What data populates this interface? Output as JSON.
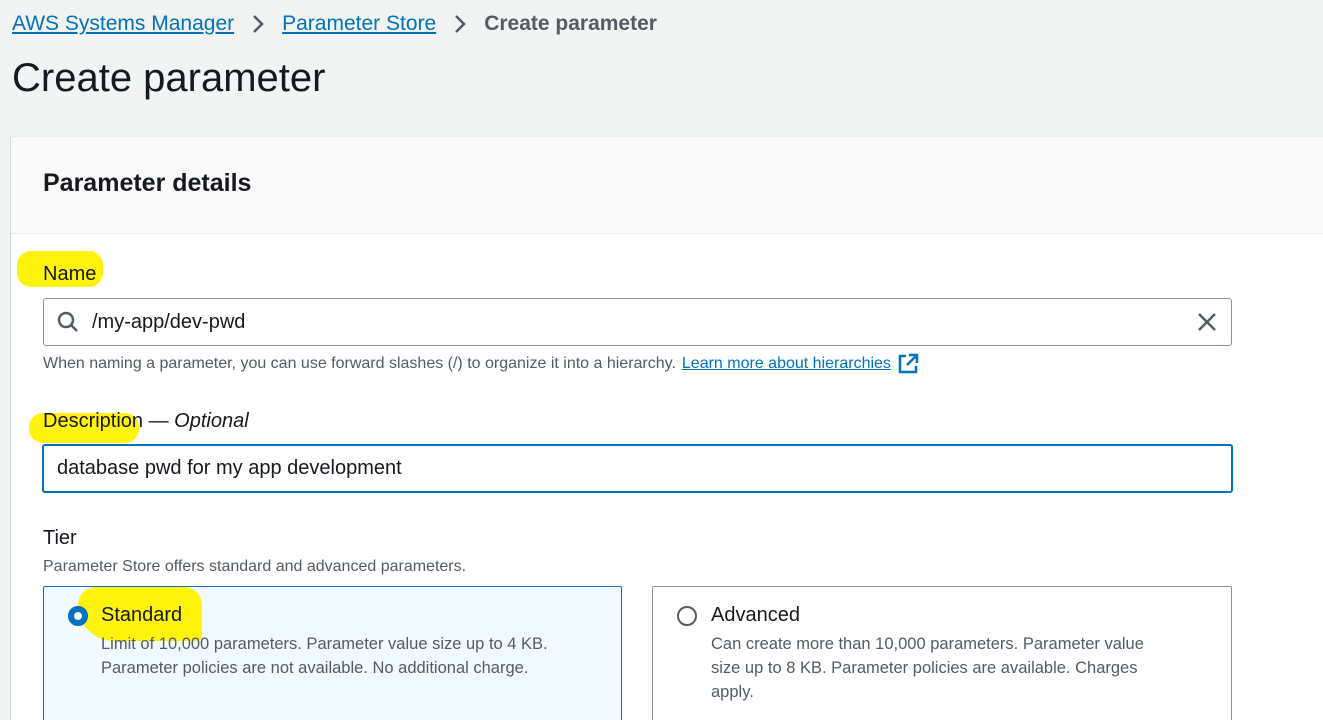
{
  "breadcrumb": {
    "items": [
      "AWS Systems Manager",
      "Parameter Store"
    ],
    "current": "Create parameter"
  },
  "page": {
    "title": "Create parameter"
  },
  "card": {
    "title": "Parameter details"
  },
  "name_field": {
    "label": "Name",
    "value": "/my-app/dev-pwd",
    "help": "When naming a parameter, you can use forward slashes (/) to organize it into a hierarchy.",
    "help_link": "Learn more about hierarchies",
    "icons": {
      "search": "search-icon",
      "clear": "close-icon",
      "external": "external-link-icon"
    }
  },
  "description_field": {
    "label": "Description",
    "optional": "Optional",
    "value": "database pwd for my app development"
  },
  "tier": {
    "label": "Tier",
    "help": "Parameter Store offers standard and advanced parameters.",
    "options": [
      {
        "title": "Standard",
        "desc_lines": [
          "Limit of 10,000 parameters. Parameter value size up to 4 KB.",
          "Parameter policies are not available. No additional charge."
        ],
        "selected": true
      },
      {
        "title": "Advanced",
        "desc_lines": [
          "Can create more than 10,000 parameters. Parameter value",
          "size up to 8 KB. Parameter policies are available. Charges",
          "apply."
        ],
        "selected": false
      }
    ]
  },
  "colors": {
    "link": "#0073bb",
    "highlight": "#fff200",
    "selected_bg": "#f1faff"
  }
}
